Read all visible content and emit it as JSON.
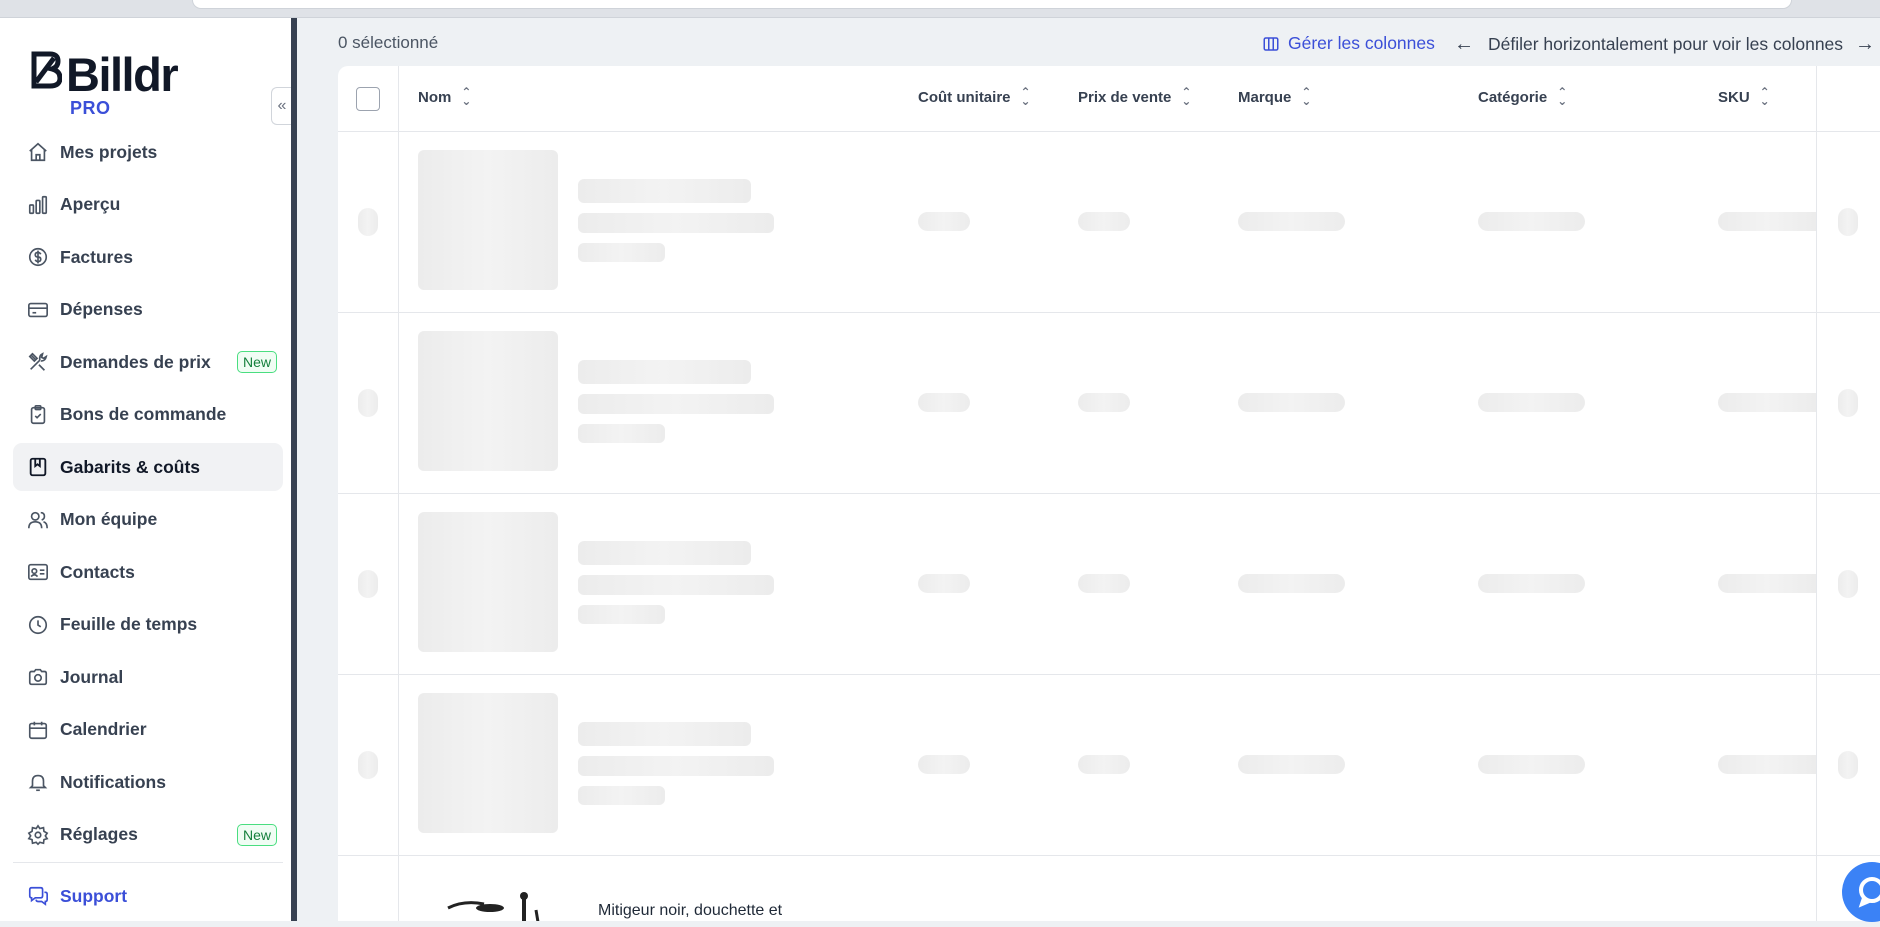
{
  "brand": {
    "name": "Billdr",
    "tier": "PRO",
    "accent": "#3b4fd8"
  },
  "sidebar": {
    "items": [
      {
        "label": "Mes projets",
        "icon": "home-icon"
      },
      {
        "label": "Aperçu",
        "icon": "bar-chart-icon"
      },
      {
        "label": "Factures",
        "icon": "dollar-circle-icon"
      },
      {
        "label": "Dépenses",
        "icon": "credit-card-icon"
      },
      {
        "label": "Demandes de prix",
        "icon": "tools-icon",
        "badge": "New"
      },
      {
        "label": "Bons de commande",
        "icon": "clipboard-check-icon"
      },
      {
        "label": "Gabarits & coûts",
        "icon": "book-icon",
        "active": true
      },
      {
        "label": "Mon équipe",
        "icon": "users-icon"
      },
      {
        "label": "Contacts",
        "icon": "id-card-icon"
      },
      {
        "label": "Feuille de temps",
        "icon": "clock-icon"
      },
      {
        "label": "Journal",
        "icon": "camera-icon"
      },
      {
        "label": "Calendrier",
        "icon": "calendar-icon"
      },
      {
        "label": "Notifications",
        "icon": "bell-icon"
      },
      {
        "label": "Réglages",
        "icon": "gear-icon",
        "badge": "New"
      }
    ],
    "support_label": "Support"
  },
  "toolbar": {
    "selected_count": "0 sélectionné",
    "manage_columns": "Gérer les colonnes",
    "scroll_hint": "Défiler horizontalement pour voir les colonnes"
  },
  "table": {
    "columns": [
      "Nom",
      "Coût unitaire",
      "Prix de vente",
      "Marque",
      "Catégorie",
      "SKU"
    ],
    "loading_rows": 4,
    "partial_row_title": "Mitigeur noir, douchette et"
  }
}
